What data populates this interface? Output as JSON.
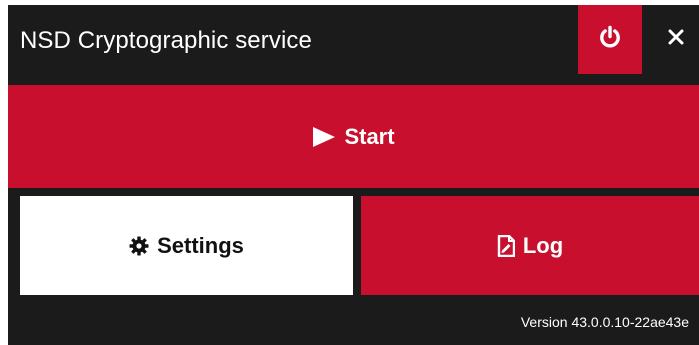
{
  "window": {
    "title": "NSD Cryptographic service",
    "version_text": "Version 43.0.0.10-22ae43e"
  },
  "titlebar": {
    "power_icon": "power-icon",
    "close_icon": "close-icon"
  },
  "actions": {
    "start_label": "Start",
    "start_icon": "play-icon",
    "settings_label": "Settings",
    "settings_icon": "gear-icon",
    "log_label": "Log",
    "log_icon": "document-icon"
  },
  "colors": {
    "accent": "#c8102e",
    "background": "#1b1b1b",
    "secondary_button": "#ffffff"
  }
}
